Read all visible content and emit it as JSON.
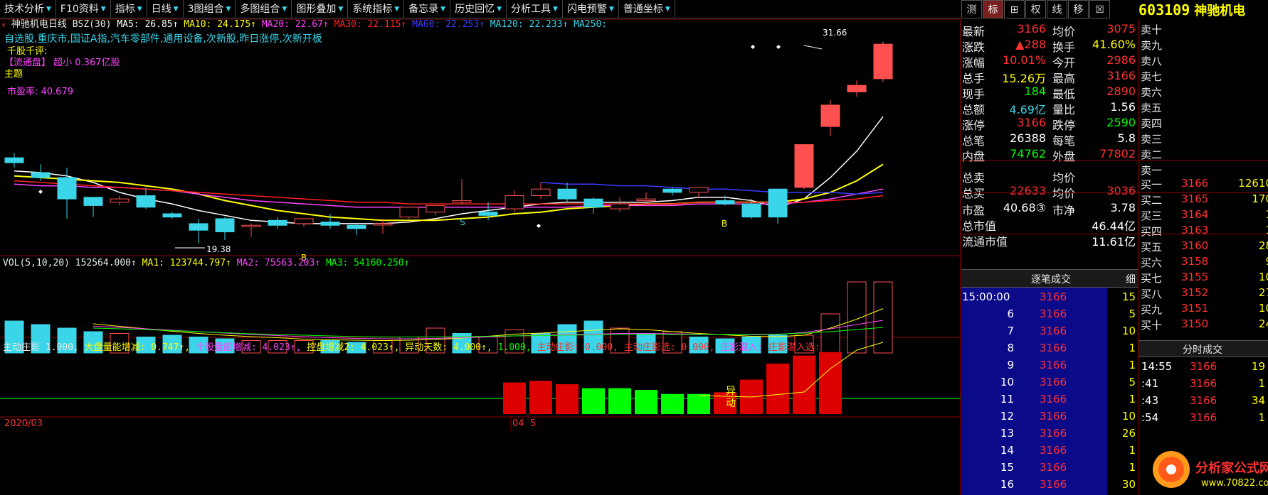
{
  "toolbar": {
    "buttons": [
      "技术分析",
      "F10资料",
      "指标",
      "日线",
      "3图组合",
      "多图组合",
      "图形叠加",
      "系统指标",
      "备忘录",
      "历史回忆",
      "分析工具",
      "闪电预警",
      "普通坐标"
    ]
  },
  "stock_tabs": [
    "测",
    "标",
    "⊞",
    "权",
    "线",
    "移",
    "☒"
  ],
  "stock": {
    "code": "603109",
    "name": "神驰机电"
  },
  "kline": {
    "title": "神驰机电日线",
    "indicator": "BSZ(30)",
    "ma5": "MA5: 26.85↑",
    "ma10": "MA10: 24.175↑",
    "ma20": "MA20: 22.67↑",
    "ma30": "MA30: 22.115↑",
    "ma60": "MA60: 22.253↑",
    "ma120": "MA120: 22.233↑",
    "ma250": "MA250:",
    "tags": "自选股,重庆市,国证A指,汽车零部件,通用设备,次新股,昨日涨停,次新开板",
    "comment": "千股千评:",
    "float_cap": "【流通盘】 超小 0.367亿股",
    "theme": "主题",
    "pe": "市盈率: 40.679",
    "high_label": "31.66",
    "low_label": "19.38",
    "signals": [
      "S",
      "S",
      "B",
      "B",
      "B"
    ]
  },
  "volume": {
    "label": "VOL(5,10,20) 152564.000↑",
    "ma1": "MA1: 123744.797↑",
    "ma2": "MA2: 75563.203↑",
    "ma3": "MA3: 54160.250↑"
  },
  "main_force": {
    "label": "主动庄影 1.000,",
    "big": "大盘量能增减: 0.747↑,",
    "stock": "个股量能增减: 4.023↑,",
    "ctrl": "控盘增减2: 4.023↑,",
    "days": "异动天数: 4.000↑,",
    "v1": "1.000,",
    "f1": "主动庄影: 0.000,",
    "f2": "主动庄影选: 0.000,",
    "f3": "庄影潜入:",
    "f4": "庄影潜入选:",
    "anomaly": "异动"
  },
  "axis": {
    "month1": "2020/03",
    "month2": "04",
    "month3": "5"
  },
  "quote": [
    {
      "l1": "最新",
      "v1": "3166",
      "c1": "#ff3030",
      "l2": "均价",
      "v2": "3075",
      "c2": "#ff3030"
    },
    {
      "l1": "涨跌",
      "v1": "▲288",
      "c1": "#ff3030",
      "l2": "换手",
      "v2": "41.60%",
      "c2": "#ffff00"
    },
    {
      "l1": "涨幅",
      "v1": "10.01%",
      "c1": "#ff3030",
      "l2": "今开",
      "v2": "2986",
      "c2": "#ff3030"
    },
    {
      "l1": "总手",
      "v1": "15.26万",
      "c1": "#ffff00",
      "l2": "最高",
      "v2": "3166",
      "c2": "#ff3030"
    },
    {
      "l1": "现手",
      "v1": "184",
      "c1": "#00ff00",
      "l2": "最低",
      "v2": "2890",
      "c2": "#ff3030"
    },
    {
      "l1": "总额",
      "v1": "4.69亿",
      "c1": "#3ad5e8",
      "l2": "量比",
      "v2": "1.56",
      "c2": "#ffffff"
    },
    {
      "l1": "涨停",
      "v1": "3166",
      "c1": "#ff3030",
      "l2": "跌停",
      "v2": "2590",
      "c2": "#00ff00"
    },
    {
      "l1": "总笔",
      "v1": "26388",
      "c1": "#ffffff",
      "l2": "每笔",
      "v2": "5.8",
      "c2": "#ffffff"
    },
    {
      "l1": "内盘",
      "v1": "74762",
      "c1": "#00ff00",
      "l2": "外盘",
      "v2": "77802",
      "c2": "#ff3030"
    },
    {
      "l1": "总卖",
      "v1": "",
      "c1": "#ffffff",
      "l2": "均价",
      "v2": "",
      "c2": "#ffffff"
    },
    {
      "l1": "总买",
      "v1": "22633",
      "c1": "#ff3030",
      "l2": "均价",
      "v2": "3036",
      "c2": "#ff3030"
    },
    {
      "l1": "市盈",
      "v1": "40.68③",
      "c1": "#ffffff",
      "l2": "市净",
      "v2": "3.78",
      "c2": "#ffffff"
    },
    {
      "l1": "总市值",
      "v1": "",
      "c1": "#ffffff",
      "l2": "",
      "v2": "46.44亿",
      "c2": "#ffffff"
    },
    {
      "l1": "流通市值",
      "v1": "",
      "c1": "#ffffff",
      "l2": "",
      "v2": "11.61亿",
      "c2": "#ffffff"
    }
  ],
  "sell_book": [
    "卖十",
    "卖九",
    "卖八",
    "卖七",
    "卖六",
    "卖五",
    "卖四",
    "卖三",
    "卖二",
    "卖一"
  ],
  "buy_book": [
    {
      "label": "买一",
      "price": "3166",
      "vol": "12610"
    },
    {
      "label": "买二",
      "price": "3165",
      "vol": "170"
    },
    {
      "label": "买三",
      "price": "3164",
      "vol": "1"
    },
    {
      "label": "买四",
      "price": "3163",
      "vol": "1"
    },
    {
      "label": "买五",
      "price": "3160",
      "vol": "28"
    },
    {
      "label": "买六",
      "price": "3158",
      "vol": "9"
    },
    {
      "label": "买七",
      "price": "3155",
      "vol": "10"
    },
    {
      "label": "买八",
      "price": "3152",
      "vol": "27"
    },
    {
      "label": "买九",
      "price": "3151",
      "vol": "10"
    },
    {
      "label": "买十",
      "price": "3150",
      "vol": "24"
    }
  ],
  "ticks_panel": {
    "title": "逐笔成交",
    "detail": "细",
    "rows": [
      {
        "time": "15:00:00",
        "price": "3166",
        "vol": "15"
      },
      {
        "time": "6",
        "price": "3166",
        "vol": "5"
      },
      {
        "time": "7",
        "price": "3166",
        "vol": "10"
      },
      {
        "time": "8",
        "price": "3166",
        "vol": "1"
      },
      {
        "time": "9",
        "price": "3166",
        "vol": "1"
      },
      {
        "time": "10",
        "price": "3166",
        "vol": "5"
      },
      {
        "time": "11",
        "price": "3166",
        "vol": "1"
      },
      {
        "time": "12",
        "price": "3166",
        "vol": "10"
      },
      {
        "time": "13",
        "price": "3166",
        "vol": "26"
      },
      {
        "time": "14",
        "price": "3166",
        "vol": "1"
      },
      {
        "time": "15",
        "price": "3166",
        "vol": "1"
      },
      {
        "time": "16",
        "price": "3166",
        "vol": "30"
      }
    ]
  },
  "minute_panel": {
    "title": "分时成交",
    "rows": [
      {
        "time": "14:55",
        "price": "3166",
        "vol": "19"
      },
      {
        "time": ":41",
        "price": "3166",
        "vol": "1"
      },
      {
        "time": ":43",
        "price": "3166",
        "vol": "34"
      },
      {
        "time": ":54",
        "price": "3166",
        "vol": "1"
      }
    ]
  },
  "footer": {
    "site": "分析家公式网",
    "url": "www.70822.com"
  },
  "chart_data": {
    "type": "candlestick",
    "price_ylim": [
      19.0,
      32.5
    ],
    "candles": [
      {
        "o": 24.6,
        "c": 24.3,
        "h": 24.9,
        "l": 24.0
      },
      {
        "o": 23.7,
        "c": 23.4,
        "h": 24.2,
        "l": 23.2
      },
      {
        "o": 23.4,
        "c": 22.1,
        "h": 24.0,
        "l": 20.9
      },
      {
        "o": 22.2,
        "c": 21.7,
        "h": 22.2,
        "l": 21.0
      },
      {
        "o": 21.9,
        "c": 22.1,
        "h": 22.3,
        "l": 21.7
      },
      {
        "o": 22.3,
        "c": 21.6,
        "h": 22.8,
        "l": 21.5
      },
      {
        "o": 21.2,
        "c": 21.0,
        "h": 21.3,
        "l": 20.9
      },
      {
        "o": 20.6,
        "c": 20.2,
        "h": 20.9,
        "l": 19.4
      },
      {
        "o": 20.9,
        "c": 20.1,
        "h": 21.0,
        "l": 19.6
      },
      {
        "o": 20.5,
        "c": 20.5,
        "h": 20.6,
        "l": 19.8
      },
      {
        "o": 20.8,
        "c": 20.5,
        "h": 21.0,
        "l": 20.3
      },
      {
        "o": 20.6,
        "c": 20.9,
        "h": 20.9,
        "l": 20.4
      },
      {
        "o": 20.7,
        "c": 20.5,
        "h": 21.2,
        "l": 20.3
      },
      {
        "o": 20.5,
        "c": 20.3,
        "h": 20.6,
        "l": 19.9
      },
      {
        "o": 20.6,
        "c": 20.6,
        "h": 20.9,
        "l": 20.0
      },
      {
        "o": 21.0,
        "c": 21.6,
        "h": 21.6,
        "l": 20.9
      },
      {
        "o": 21.3,
        "c": 21.7,
        "h": 21.7,
        "l": 21.1
      },
      {
        "o": 21.9,
        "c": 22.0,
        "h": 23.3,
        "l": 21.8
      },
      {
        "o": 21.3,
        "c": 21.1,
        "h": 21.9,
        "l": 20.8
      },
      {
        "o": 21.5,
        "c": 22.3,
        "h": 22.6,
        "l": 21.3
      },
      {
        "o": 22.3,
        "c": 22.7,
        "h": 23.1,
        "l": 22.1
      },
      {
        "o": 22.7,
        "c": 22.1,
        "h": 23.1,
        "l": 21.9
      },
      {
        "o": 22.1,
        "c": 21.6,
        "h": 22.2,
        "l": 21.2
      },
      {
        "o": 21.5,
        "c": 21.8,
        "h": 22.2,
        "l": 21.3
      },
      {
        "o": 22.0,
        "c": 22.1,
        "h": 22.5,
        "l": 21.9
      },
      {
        "o": 22.7,
        "c": 22.5,
        "h": 22.8,
        "l": 22.3
      },
      {
        "o": 22.5,
        "c": 22.8,
        "h": 22.8,
        "l": 22.2
      },
      {
        "o": 22.0,
        "c": 21.8,
        "h": 22.3,
        "l": 21.7
      },
      {
        "o": 21.8,
        "c": 21.0,
        "h": 22.1,
        "l": 20.9
      },
      {
        "o": 22.7,
        "c": 21.0,
        "h": 22.7,
        "l": 20.6
      },
      {
        "o": 22.8,
        "c": 25.4,
        "h": 25.4,
        "l": 22.7
      },
      {
        "o": 26.5,
        "c": 27.8,
        "h": 28.1,
        "l": 25.9
      },
      {
        "o": 28.6,
        "c": 29.0,
        "h": 29.3,
        "l": 28.3
      },
      {
        "o": 29.4,
        "c": 31.5,
        "h": 31.66,
        "l": 29.2
      }
    ],
    "ma_series": [
      {
        "name": "MA5",
        "color": "#ffffff",
        "values": [
          23.8,
          23.7,
          23.5,
          23.1,
          22.5,
          22.1,
          21.8,
          21.4,
          21.1,
          20.8,
          20.7,
          20.6,
          20.6,
          20.6,
          20.6,
          20.7,
          20.9,
          21.2,
          21.4,
          21.6,
          21.8,
          21.9,
          21.9,
          21.9,
          21.9,
          22.0,
          22.2,
          22.2,
          22.0,
          21.6,
          22.1,
          23.4,
          25.0,
          27.1
        ]
      },
      {
        "name": "MA10",
        "color": "#ffff00",
        "values": [
          23.5,
          23.4,
          23.3,
          23.2,
          23.1,
          22.9,
          22.7,
          22.4,
          22.0,
          21.7,
          21.4,
          21.2,
          21.0,
          20.9,
          20.8,
          20.8,
          20.8,
          20.9,
          21.0,
          21.2,
          21.3,
          21.5,
          21.6,
          21.7,
          21.8,
          21.8,
          21.9,
          21.9,
          21.9,
          21.9,
          22.1,
          22.5,
          23.2,
          24.2
        ]
      },
      {
        "name": "MA20",
        "color": "#ff44ff",
        "values": [
          23.0,
          22.9,
          22.9,
          22.8,
          22.8,
          22.7,
          22.6,
          22.4,
          22.2,
          22.0,
          21.9,
          21.8,
          21.7,
          21.6,
          21.6,
          21.6,
          21.6,
          21.6,
          21.6,
          21.6,
          21.6,
          21.6,
          21.7,
          21.7,
          21.7,
          21.7,
          21.8,
          21.8,
          21.8,
          21.8,
          21.9,
          22.1,
          22.4,
          22.7
        ]
      },
      {
        "name": "MA30",
        "color": "#ff2020",
        "values": [
          23.2,
          23.1,
          23.0,
          22.9,
          22.8,
          22.7,
          22.6,
          22.5,
          22.4,
          22.3,
          22.2,
          22.1,
          22.0,
          21.9,
          21.9,
          21.8,
          21.8,
          21.8,
          21.8,
          21.8,
          21.8,
          21.8,
          21.8,
          21.8,
          21.8,
          21.8,
          21.9,
          21.9,
          21.9,
          21.9,
          21.9,
          22.0,
          22.1,
          22.3
        ]
      },
      {
        "name": "MA60",
        "color": "#3b3bff",
        "values": [
          null,
          null,
          null,
          null,
          null,
          null,
          null,
          null,
          null,
          null,
          null,
          null,
          null,
          null,
          null,
          null,
          null,
          null,
          null,
          null,
          23.1,
          23.0,
          23.0,
          22.9,
          22.9,
          22.8,
          22.7,
          22.7,
          22.6,
          22.5,
          22.5,
          22.5,
          22.4,
          22.5
        ]
      }
    ],
    "volume": [
      0.9,
      0.8,
      0.7,
      0.6,
      0.55,
      0.45,
      0.5,
      0.45,
      0.4,
      0.35,
      0.35,
      0.35,
      0.35,
      0.3,
      0.35,
      0.45,
      0.7,
      0.55,
      0.45,
      0.65,
      0.55,
      0.8,
      0.9,
      0.7,
      0.55,
      0.6,
      0.45,
      0.4,
      0.45,
      0.5,
      0.5,
      1.1,
      2.0,
      2.0
    ],
    "volume_up": [
      false,
      false,
      false,
      false,
      true,
      false,
      false,
      false,
      false,
      true,
      true,
      true,
      false,
      false,
      true,
      true,
      true,
      false,
      true,
      true,
      false,
      false,
      false,
      true,
      false,
      true,
      false,
      false,
      false,
      false,
      true,
      true,
      true,
      true
    ],
    "force": [
      0,
      0,
      0,
      0,
      0,
      0,
      0,
      0,
      0,
      0,
      0,
      0,
      0,
      0,
      0,
      0,
      0,
      0,
      0,
      0,
      0,
      0.45,
      0.45,
      0.42,
      0.35,
      0.35,
      0.33,
      0.3,
      0.32,
      0.6,
      0.95,
      1.25,
      1.3,
      0,
      0,
      0
    ],
    "force_colors": [
      "r",
      "r",
      "r",
      "g",
      "g",
      "g",
      "g",
      "g",
      "r",
      "r",
      "r",
      "r",
      "r"
    ]
  }
}
